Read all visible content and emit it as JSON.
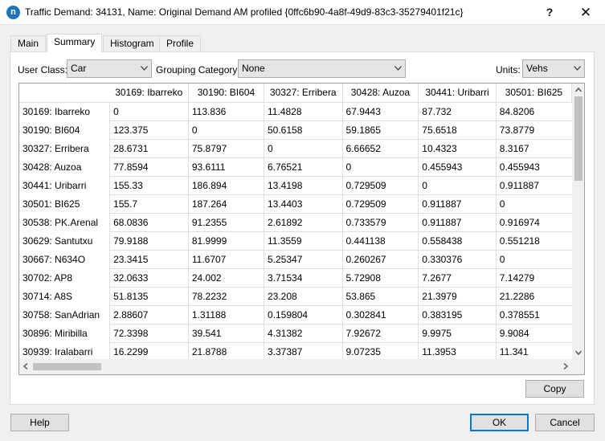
{
  "window": {
    "title": "Traffic Demand: 34131, Name: Original Demand AM profiled  {0ffc6b90-4a8f-49d9-83c3-35279401f21c}",
    "app_icon_letter": "n",
    "help_symbol": "?",
    "close_symbol": "✕"
  },
  "tabs": [
    {
      "label": "Main",
      "active": false
    },
    {
      "label": "Summary",
      "active": true
    },
    {
      "label": "Histogram",
      "active": false
    },
    {
      "label": "Profile",
      "active": false
    }
  ],
  "filters": {
    "user_class_label": "User Class:",
    "user_class_value": "Car",
    "grouping_label": "Grouping Category:",
    "grouping_value": "None",
    "units_label": "Units:",
    "units_value": "Vehs"
  },
  "matrix": {
    "columns": [
      "30169: Ibarreko",
      "30190: BI604",
      "30327: Erribera",
      "30428: Auzoa",
      "30441: Uribarri",
      "30501: BI625"
    ],
    "rows": [
      {
        "label": "30169: Ibarreko",
        "values": [
          "0",
          "113.836",
          "11.4828",
          "67.9443",
          "87.732",
          "84.8206"
        ]
      },
      {
        "label": "30190: BI604",
        "values": [
          "123.375",
          "0",
          "50.6158",
          "59.1865",
          "75.6518",
          "73.8779"
        ]
      },
      {
        "label": "30327: Erribera",
        "values": [
          "28.6731",
          "75.8797",
          "0",
          "6.66652",
          "10.4323",
          "8.3167"
        ]
      },
      {
        "label": "30428: Auzoa",
        "values": [
          "77.8594",
          "93.6111",
          "6.76521",
          "0",
          "0.455943",
          "0.455943"
        ]
      },
      {
        "label": "30441: Uribarri",
        "values": [
          "155.33",
          "186.894",
          "13.4198",
          "0.729509",
          "0",
          "0.911887"
        ]
      },
      {
        "label": "30501: BI625",
        "values": [
          "155.7",
          "187.264",
          "13.4403",
          "0.729509",
          "0.911887",
          "0"
        ]
      },
      {
        "label": "30538: PK.Arenal",
        "values": [
          "68.0836",
          "91.2355",
          "2.61892",
          "0.733579",
          "0.911887",
          "0.916974"
        ]
      },
      {
        "label": "30629: Santutxu",
        "values": [
          "79.9188",
          "81.9999",
          "11.3559",
          "0.441138",
          "0.558438",
          "0.551218"
        ]
      },
      {
        "label": "30667: N634O",
        "values": [
          "23.3415",
          "11.6707",
          "5.25347",
          "0.260267",
          "0.330376",
          "0"
        ]
      },
      {
        "label": "30702: AP8",
        "values": [
          "32.0633",
          "24.002",
          "3.71534",
          "5.72908",
          "7.2677",
          "7.14279"
        ]
      },
      {
        "label": "30714: A8S",
        "values": [
          "51.8135",
          "78.2232",
          "23.208",
          "53.865",
          "21.3979",
          "21.2286"
        ]
      },
      {
        "label": "30758: SanAdrian",
        "values": [
          "2.88607",
          "1.31188",
          "0.159804",
          "0.302841",
          "0.383195",
          "0.378551"
        ]
      },
      {
        "label": "30896: Miribilla",
        "values": [
          "72.3398",
          "39.541",
          "4.31382",
          "7.92672",
          "9.9975",
          "9.9084"
        ]
      },
      {
        "label": "30939: Iralabarri",
        "values": [
          "16.2299",
          "21.8788",
          "3.37387",
          "9.07235",
          "11.3953",
          "11.341"
        ]
      },
      {
        "label": "",
        "values": [
          "",
          "",
          "",
          "",
          "",
          ""
        ]
      }
    ]
  },
  "buttons": {
    "copy": "Copy",
    "help": "Help",
    "ok": "OK",
    "cancel": "Cancel"
  },
  "colors": {
    "accent": "#0078d7",
    "app_icon": "#1e73be"
  }
}
